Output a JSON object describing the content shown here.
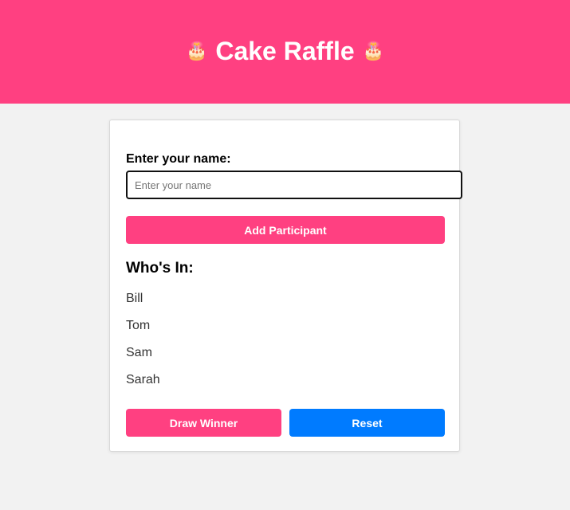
{
  "colors": {
    "brand": "#ff4081",
    "reset": "#007bff",
    "background": "#f2f2f2"
  },
  "header": {
    "title": "Cake Raffle",
    "icon_left": "cake-icon",
    "icon_right": "cake-icon",
    "icon_glyph": "🎂"
  },
  "form": {
    "label": "Enter your name:",
    "placeholder": "Enter your name",
    "value": "",
    "add_button": "Add Participant"
  },
  "participants": {
    "title": "Who's In:",
    "items": [
      "Bill",
      "Tom",
      "Sam",
      "Sarah"
    ]
  },
  "actions": {
    "draw_button": "Draw Winner",
    "reset_button": "Reset"
  }
}
